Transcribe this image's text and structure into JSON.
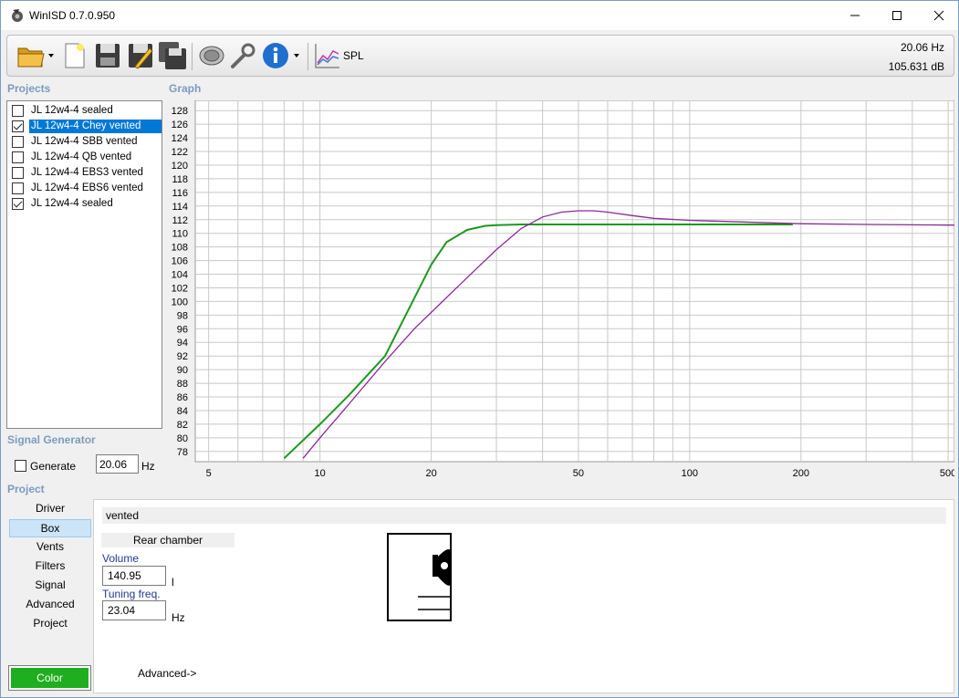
{
  "window": {
    "title": "WinISD 0.7.0.950"
  },
  "toolbar": {
    "spl_label": "SPL",
    "readout_freq": "20.06 Hz",
    "readout_db": "105.631 dB"
  },
  "projects": {
    "header": "Projects",
    "items": [
      {
        "label": "JL 12w4-4 sealed",
        "checked": false,
        "selected": false
      },
      {
        "label": "JL 12w4-4 Chey vented",
        "checked": true,
        "selected": true
      },
      {
        "label": "JL 12w4-4 SBB vented",
        "checked": false,
        "selected": false
      },
      {
        "label": "JL 12w4-4 QB vented",
        "checked": false,
        "selected": false
      },
      {
        "label": "JL 12w4-4 EBS3 vented",
        "checked": false,
        "selected": false
      },
      {
        "label": "JL 12w4-4 EBS6 vented",
        "checked": false,
        "selected": false
      },
      {
        "label": "JL 12w4-4 sealed",
        "checked": true,
        "selected": false
      }
    ]
  },
  "graph": {
    "header": "Graph"
  },
  "chart_data": {
    "type": "line",
    "xscale": "log",
    "xlim": [
      4.6,
      520
    ],
    "ylim": [
      76.5,
      129.5
    ],
    "xticks": [
      5,
      10,
      20,
      50,
      100,
      200,
      500
    ],
    "yticks": [
      78,
      80,
      82,
      84,
      86,
      88,
      90,
      92,
      94,
      96,
      98,
      100,
      102,
      104,
      106,
      108,
      110,
      112,
      114,
      116,
      118,
      120,
      122,
      124,
      126,
      128
    ],
    "grid": true,
    "series": [
      {
        "color": "#1a9a1a",
        "x": [
          8,
          10,
          12,
          15,
          18,
          20,
          22,
          25,
          28,
          30,
          35,
          40,
          50,
          70,
          100,
          150,
          190
        ],
        "y": [
          77.0,
          82.0,
          86.3,
          92.0,
          100.5,
          105.4,
          108.7,
          110.5,
          111.1,
          111.2,
          111.3,
          111.3,
          111.3,
          111.3,
          111.3,
          111.3,
          111.3
        ]
      },
      {
        "color": "#8a2a9a",
        "x": [
          9,
          10,
          12,
          15,
          18,
          20,
          25,
          30,
          35,
          40,
          45,
          50,
          55,
          60,
          70,
          80,
          100,
          150,
          200,
          300,
          500,
          520
        ],
        "y": [
          77.0,
          80.0,
          85.0,
          91.2,
          96.0,
          98.4,
          103.5,
          107.6,
          110.7,
          112.4,
          113.1,
          113.3,
          113.3,
          113.1,
          112.6,
          112.2,
          111.9,
          111.6,
          111.4,
          111.3,
          111.2,
          111.2
        ]
      }
    ]
  },
  "signal_generator": {
    "header": "Signal Generator",
    "generate_label": "Generate",
    "generate_checked": false,
    "freq_value": "20.06",
    "unit": "Hz"
  },
  "project": {
    "header": "Project",
    "nav": [
      "Driver",
      "Box",
      "Vents",
      "Filters",
      "Signal",
      "Advanced",
      "Project"
    ],
    "active_nav": "Box",
    "color_label": "Color"
  },
  "box_panel": {
    "type": "vented",
    "rear_chamber": "Rear chamber",
    "volume_label": "Volume",
    "volume_value": "140.95",
    "volume_unit": "l",
    "tuning_label": "Tuning freq.",
    "tuning_value": "23.04",
    "tuning_unit": "Hz",
    "advanced_label": "Advanced->"
  }
}
